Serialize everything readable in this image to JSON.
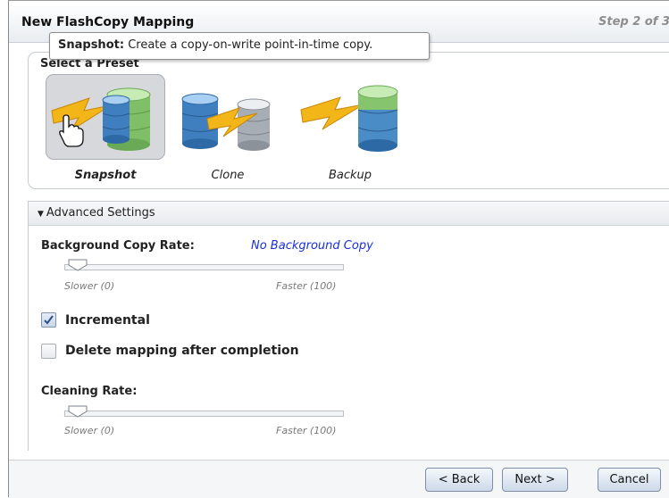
{
  "dialog": {
    "title": "New FlashCopy Mapping",
    "step": "Step 2 of 3"
  },
  "tooltip": {
    "term": "Snapshot:",
    "text": "Create a copy-on-write point-in-time copy."
  },
  "presets": {
    "title": "Select a Preset",
    "items": [
      {
        "label": "Snapshot",
        "selected": true
      },
      {
        "label": "Clone",
        "selected": false
      },
      {
        "label": "Backup",
        "selected": false
      }
    ]
  },
  "advanced": {
    "header": "Advanced Settings",
    "background_copy_rate": {
      "label": "Background Copy Rate:",
      "value_text": "No Background Copy",
      "value": 0,
      "min_label": "Slower (0)",
      "max_label": "Faster (100)"
    },
    "incremental": {
      "label": "Incremental",
      "checked": true
    },
    "delete_mapping": {
      "label": "Delete mapping after completion",
      "checked": false
    },
    "cleaning_rate": {
      "label": "Cleaning Rate:",
      "value": 0,
      "min_label": "Slower (0)",
      "max_label": "Faster (100)"
    }
  },
  "buttons": {
    "back": "< Back",
    "next": "Next >",
    "cancel": "Cancel"
  },
  "colors": {
    "accent_blue": "#1a2fd8",
    "lightning_yellow": "#f2b619",
    "db_blue": "#3f7fbf",
    "db_green": "#86c56e"
  }
}
